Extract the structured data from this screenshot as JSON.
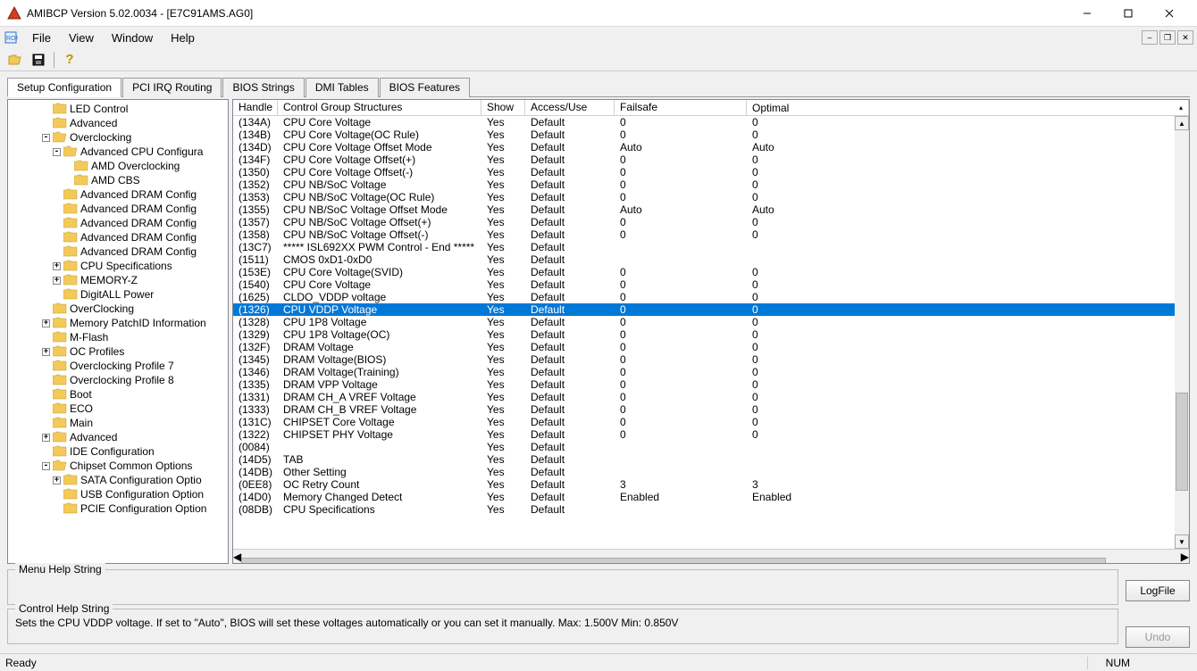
{
  "window": {
    "title": "AMIBCP Version 5.02.0034 - [E7C91AMS.AG0]"
  },
  "menu": {
    "items": [
      "File",
      "View",
      "Window",
      "Help"
    ]
  },
  "tabs": {
    "items": [
      "Setup Configuration",
      "PCI IRQ Routing",
      "BIOS Strings",
      "DMI Tables",
      "BIOS Features"
    ],
    "active": 0
  },
  "tree": {
    "items": [
      {
        "indent": 3,
        "toggle": "",
        "icon": "folder",
        "label": "LED Control"
      },
      {
        "indent": 3,
        "toggle": "",
        "icon": "folder",
        "label": "Advanced"
      },
      {
        "indent": 3,
        "toggle": "-",
        "icon": "folder-open",
        "label": "Overclocking"
      },
      {
        "indent": 4,
        "toggle": "-",
        "icon": "folder-open",
        "label": "Advanced CPU Configura"
      },
      {
        "indent": 5,
        "toggle": "",
        "icon": "folder",
        "label": "AMD Overclocking"
      },
      {
        "indent": 5,
        "toggle": "",
        "icon": "folder",
        "label": "AMD CBS"
      },
      {
        "indent": 4,
        "toggle": "",
        "icon": "folder",
        "label": "Advanced DRAM Config"
      },
      {
        "indent": 4,
        "toggle": "",
        "icon": "folder",
        "label": "Advanced DRAM Config"
      },
      {
        "indent": 4,
        "toggle": "",
        "icon": "folder",
        "label": "Advanced DRAM Config"
      },
      {
        "indent": 4,
        "toggle": "",
        "icon": "folder",
        "label": "Advanced DRAM Config"
      },
      {
        "indent": 4,
        "toggle": "",
        "icon": "folder",
        "label": "Advanced DRAM Config"
      },
      {
        "indent": 4,
        "toggle": "+",
        "icon": "folder",
        "label": "CPU Specifications"
      },
      {
        "indent": 4,
        "toggle": "+",
        "icon": "folder",
        "label": "MEMORY-Z"
      },
      {
        "indent": 4,
        "toggle": "",
        "icon": "folder",
        "label": "DigitALL Power"
      },
      {
        "indent": 3,
        "toggle": "",
        "icon": "folder",
        "label": "OverClocking"
      },
      {
        "indent": 3,
        "toggle": "+",
        "icon": "folder",
        "label": "Memory PatchID Information"
      },
      {
        "indent": 3,
        "toggle": "",
        "icon": "folder",
        "label": "M-Flash"
      },
      {
        "indent": 3,
        "toggle": "+",
        "icon": "folder",
        "label": "OC Profiles"
      },
      {
        "indent": 3,
        "toggle": "",
        "icon": "folder",
        "label": "Overclocking Profile 7"
      },
      {
        "indent": 3,
        "toggle": "",
        "icon": "folder",
        "label": "Overclocking Profile 8"
      },
      {
        "indent": 3,
        "toggle": "",
        "icon": "folder",
        "label": "Boot"
      },
      {
        "indent": 3,
        "toggle": "",
        "icon": "folder",
        "label": "ECO"
      },
      {
        "indent": 3,
        "toggle": "",
        "icon": "folder",
        "label": "Main"
      },
      {
        "indent": 3,
        "toggle": "+",
        "icon": "folder",
        "label": "Advanced"
      },
      {
        "indent": 3,
        "toggle": "",
        "icon": "folder",
        "label": "IDE Configuration"
      },
      {
        "indent": 3,
        "toggle": "-",
        "icon": "folder-open",
        "label": "Chipset Common Options"
      },
      {
        "indent": 4,
        "toggle": "+",
        "icon": "folder",
        "label": "SATA Configuration Optio"
      },
      {
        "indent": 4,
        "toggle": "",
        "icon": "folder",
        "label": "USB Configuration Option"
      },
      {
        "indent": 4,
        "toggle": "",
        "icon": "folder",
        "label": "PCIE Configuration Option"
      }
    ]
  },
  "table": {
    "columns": [
      "Handle",
      "Control Group Structures",
      "Show",
      "Access/Use",
      "Failsafe",
      "Optimal"
    ],
    "selected": 15,
    "rows": [
      {
        "handle": "(134A)",
        "struct": "CPU Core Voltage",
        "show": "Yes",
        "access": "Default",
        "failsafe": "0",
        "optimal": "0"
      },
      {
        "handle": "(134B)",
        "struct": "CPU Core Voltage(OC Rule)",
        "show": "Yes",
        "access": "Default",
        "failsafe": "0",
        "optimal": "0"
      },
      {
        "handle": "(134D)",
        "struct": "CPU Core Voltage Offset Mode",
        "show": "Yes",
        "access": "Default",
        "failsafe": "Auto",
        "optimal": "Auto"
      },
      {
        "handle": "(134F)",
        "struct": "CPU Core Voltage Offset(+)",
        "show": "Yes",
        "access": "Default",
        "failsafe": "0",
        "optimal": "0"
      },
      {
        "handle": "(1350)",
        "struct": "CPU Core Voltage Offset(-)",
        "show": "Yes",
        "access": "Default",
        "failsafe": "0",
        "optimal": "0"
      },
      {
        "handle": "(1352)",
        "struct": "CPU NB/SoC Voltage",
        "show": "Yes",
        "access": "Default",
        "failsafe": "0",
        "optimal": "0"
      },
      {
        "handle": "(1353)",
        "struct": "CPU NB/SoC Voltage(OC Rule)",
        "show": "Yes",
        "access": "Default",
        "failsafe": "0",
        "optimal": "0"
      },
      {
        "handle": "(1355)",
        "struct": "CPU NB/SoC Voltage Offset Mode",
        "show": "Yes",
        "access": "Default",
        "failsafe": "Auto",
        "optimal": "Auto"
      },
      {
        "handle": "(1357)",
        "struct": "CPU NB/SoC Voltage Offset(+)",
        "show": "Yes",
        "access": "Default",
        "failsafe": "0",
        "optimal": "0"
      },
      {
        "handle": "(1358)",
        "struct": "CPU NB/SoC Voltage Offset(-)",
        "show": "Yes",
        "access": "Default",
        "failsafe": "0",
        "optimal": "0"
      },
      {
        "handle": "(13C7)",
        "struct": "*****  ISL692XX PWM Control  -  End   *****",
        "show": "Yes",
        "access": "Default",
        "failsafe": "",
        "optimal": ""
      },
      {
        "handle": "(1511)",
        "struct": "CMOS 0xD1-0xD0",
        "show": "Yes",
        "access": "Default",
        "failsafe": "",
        "optimal": ""
      },
      {
        "handle": "(153E)",
        "struct": "CPU Core Voltage(SVID)",
        "show": "Yes",
        "access": "Default",
        "failsafe": "0",
        "optimal": "0"
      },
      {
        "handle": "(1540)",
        "struct": "CPU Core Voltage",
        "show": "Yes",
        "access": "Default",
        "failsafe": "0",
        "optimal": "0"
      },
      {
        "handle": "(1625)",
        "struct": "CLDO_VDDP voltage",
        "show": "Yes",
        "access": "Default",
        "failsafe": "0",
        "optimal": "0"
      },
      {
        "handle": "(1326)",
        "struct": "CPU VDDP Voltage",
        "show": "Yes",
        "access": "Default",
        "failsafe": "0",
        "optimal": "0"
      },
      {
        "handle": "(1328)",
        "struct": "CPU 1P8 Voltage",
        "show": "Yes",
        "access": "Default",
        "failsafe": "0",
        "optimal": "0"
      },
      {
        "handle": "(1329)",
        "struct": "CPU 1P8 Voltage(OC)",
        "show": "Yes",
        "access": "Default",
        "failsafe": "0",
        "optimal": "0"
      },
      {
        "handle": "(132F)",
        "struct": "DRAM Voltage",
        "show": "Yes",
        "access": "Default",
        "failsafe": "0",
        "optimal": "0"
      },
      {
        "handle": "(1345)",
        "struct": "DRAM Voltage(BIOS)",
        "show": "Yes",
        "access": "Default",
        "failsafe": "0",
        "optimal": "0"
      },
      {
        "handle": "(1346)",
        "struct": "DRAM Voltage(Training)",
        "show": "Yes",
        "access": "Default",
        "failsafe": "0",
        "optimal": "0"
      },
      {
        "handle": "(1335)",
        "struct": "DRAM VPP Voltage",
        "show": "Yes",
        "access": "Default",
        "failsafe": "0",
        "optimal": "0"
      },
      {
        "handle": "(1331)",
        "struct": "DRAM CH_A VREF Voltage",
        "show": "Yes",
        "access": "Default",
        "failsafe": "0",
        "optimal": "0"
      },
      {
        "handle": "(1333)",
        "struct": "DRAM CH_B VREF Voltage",
        "show": "Yes",
        "access": "Default",
        "failsafe": "0",
        "optimal": "0"
      },
      {
        "handle": "(131C)",
        "struct": "CHIPSET Core Voltage",
        "show": "Yes",
        "access": "Default",
        "failsafe": "0",
        "optimal": "0"
      },
      {
        "handle": "(1322)",
        "struct": "CHIPSET PHY Voltage",
        "show": "Yes",
        "access": "Default",
        "failsafe": "0",
        "optimal": "0"
      },
      {
        "handle": "(0084)",
        "struct": "",
        "show": "Yes",
        "access": "Default",
        "failsafe": "",
        "optimal": ""
      },
      {
        "handle": "(14D5)",
        "struct": "TAB",
        "show": "Yes",
        "access": "Default",
        "failsafe": "",
        "optimal": ""
      },
      {
        "handle": "(14DB)",
        "struct": "Other Setting",
        "show": "Yes",
        "access": "Default",
        "failsafe": "",
        "optimal": ""
      },
      {
        "handle": "(0EE8)",
        "struct": "OC Retry Count",
        "show": "Yes",
        "access": "Default",
        "failsafe": "3",
        "optimal": "3"
      },
      {
        "handle": "(14D0)",
        "struct": "Memory Changed Detect",
        "show": "Yes",
        "access": "Default",
        "failsafe": "Enabled",
        "optimal": "Enabled"
      },
      {
        "handle": "(08DB)",
        "struct": "CPU Specifications",
        "show": "Yes",
        "access": "Default",
        "failsafe": "",
        "optimal": ""
      }
    ]
  },
  "groupboxes": {
    "menu_help_title": "Menu Help String",
    "menu_help_text": "",
    "control_help_title": "Control Help String",
    "control_help_text": "Sets the CPU VDDP voltage. If set to \"Auto\", BIOS will set these voltages automatically or you can set it manually.   Max: 1.500V  Min: 0.850V"
  },
  "buttons": {
    "logfile": "LogFile",
    "undo": "Undo"
  },
  "statusbar": {
    "left": "Ready",
    "num": "NUM"
  }
}
